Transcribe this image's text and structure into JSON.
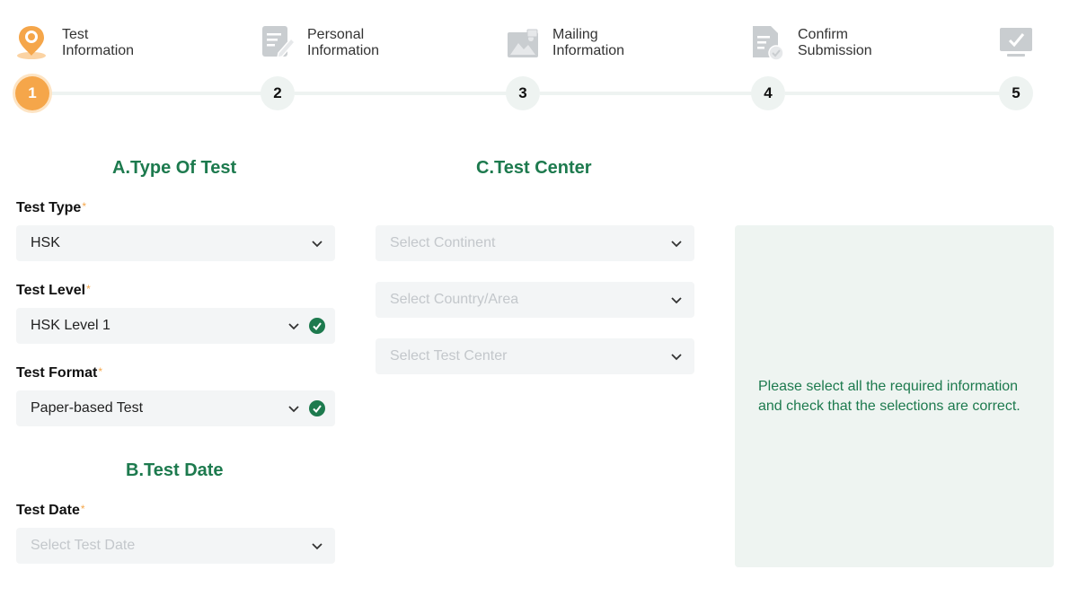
{
  "steps": [
    {
      "title_line1": "Test",
      "title_line2": "Information",
      "number": "1",
      "icon": "location-pin-icon",
      "active": true
    },
    {
      "title_line1": "Personal",
      "title_line2": "Information",
      "number": "2",
      "icon": "edit-document-icon",
      "active": false
    },
    {
      "title_line1": "Mailing",
      "title_line2": "Information",
      "number": "3",
      "icon": "image-mail-icon",
      "active": false
    },
    {
      "title_line1": "Confirm",
      "title_line2": "Submission",
      "number": "4",
      "icon": "document-check-icon",
      "active": false
    },
    {
      "title_line1": "",
      "title_line2": "",
      "number": "5",
      "icon": "monitor-check-icon",
      "active": false
    }
  ],
  "colors": {
    "accent": "#f5a64a",
    "primary_green": "#1d7a4e",
    "field_bg": "#f3f5f6",
    "info_bg": "#eef4f1"
  },
  "section_a": {
    "title": "A.Type Of Test",
    "test_type": {
      "label": "Test Type",
      "required": "*",
      "value": "HSK"
    },
    "test_level": {
      "label": "Test Level",
      "required": "*",
      "value": "HSK Level 1"
    },
    "test_format": {
      "label": "Test Format",
      "required": "*",
      "value": "Paper-based Test"
    }
  },
  "section_b": {
    "title": "B.Test Date",
    "test_date": {
      "label": "Test Date",
      "required": "*",
      "placeholder": "Select Test Date"
    }
  },
  "section_c": {
    "title": "C.Test Center",
    "continent_placeholder": "Select Continent",
    "country_placeholder": "Select Country/Area",
    "center_placeholder": "Select Test Center"
  },
  "info": {
    "line1": "Please select all the required information",
    "line2": "and check that the selections are correct."
  }
}
